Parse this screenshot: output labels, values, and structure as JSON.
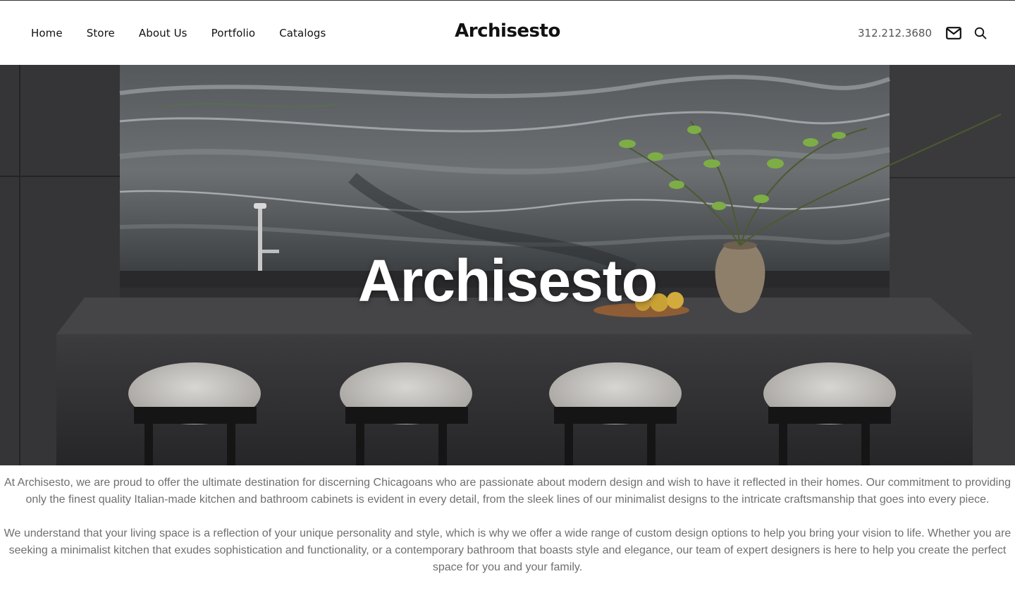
{
  "nav": {
    "items": [
      {
        "label": "Home"
      },
      {
        "label": "Store"
      },
      {
        "label": "About Us"
      },
      {
        "label": "Portfolio"
      },
      {
        "label": "Catalogs"
      }
    ]
  },
  "brand": "Archisesto",
  "contact": {
    "phone": "312.212.3680",
    "mail_icon": "envelope-icon",
    "search_icon": "magnifier-icon"
  },
  "hero": {
    "title": "Archisesto"
  },
  "body": {
    "paragraphs": [
      "At Archisesto, we are proud to offer the ultimate destination for discerning Chicagoans who are passionate about modern design and wish to have it reflected in their homes. Our commitment to providing only the finest quality Italian-made kitchen and bathroom cabinets is evident in every detail, from the sleek lines of our minimalist designs to the intricate craftsmanship that goes into every piece.",
      "We understand that your living space is a reflection of your unique personality and style, which is why we offer a wide range of custom design options to help you bring your vision to life. Whether you are seeking a minimalist kitchen that exudes sophistication and functionality, or a contemporary bathroom that boasts style and elegance, our team of expert designers is here to help you create the perfect space for you and your family."
    ]
  },
  "colors": {
    "text_dark": "#111111",
    "text_muted": "#6f6f6f",
    "hero_bg": "#2e2e30"
  }
}
